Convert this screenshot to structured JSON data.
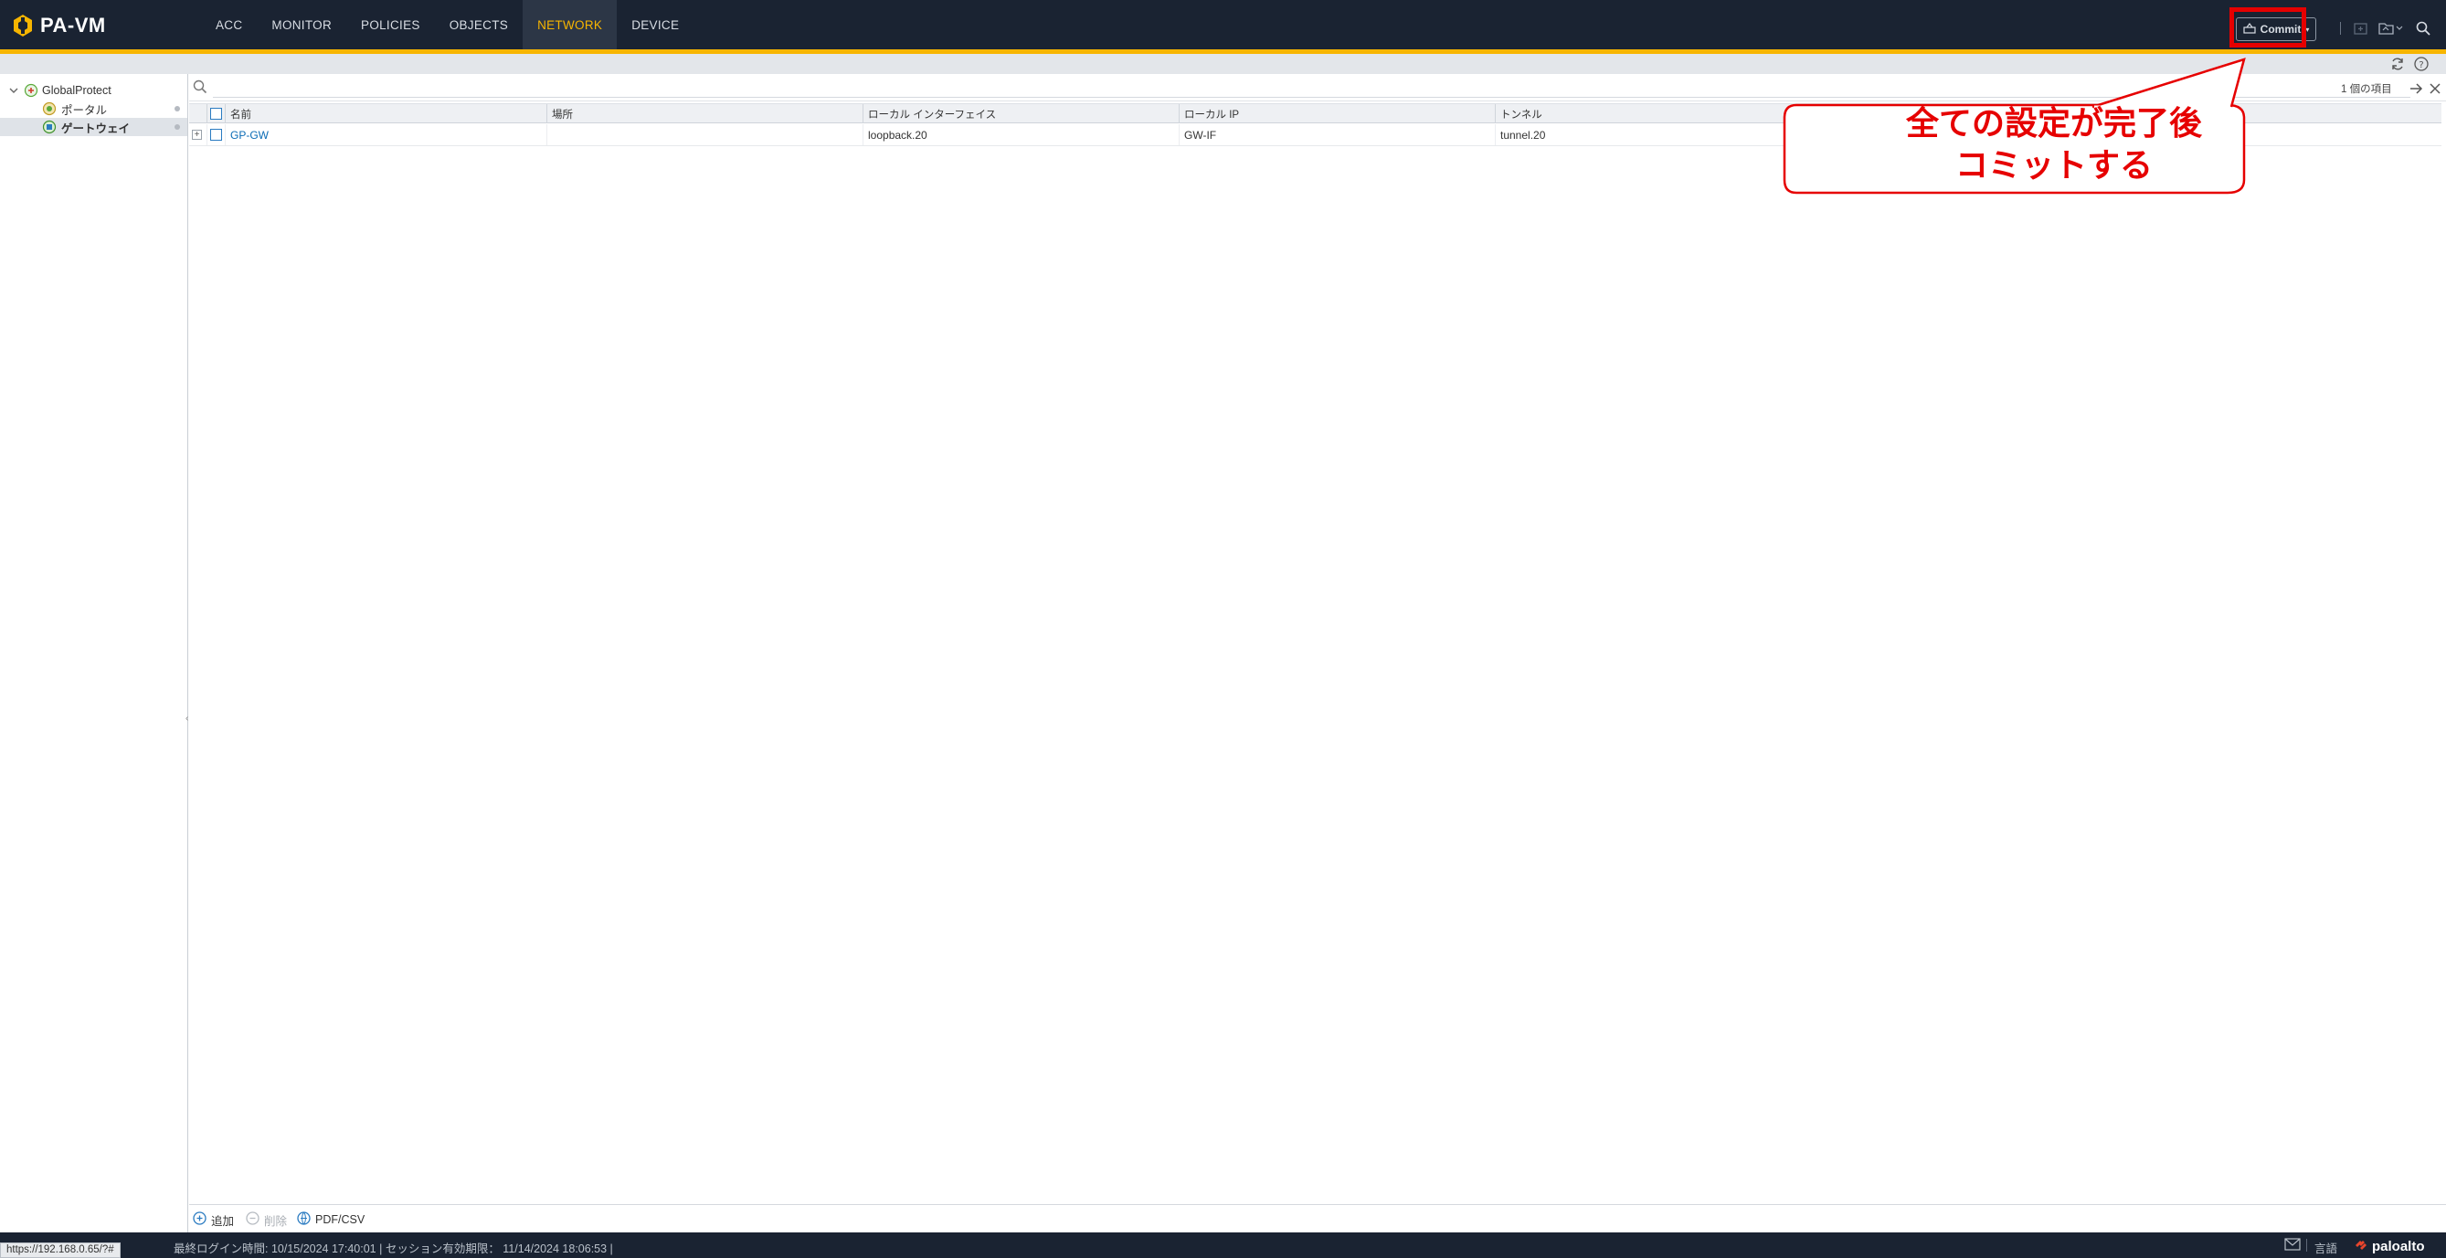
{
  "app": {
    "title": "PA-VM",
    "nav": [
      "ACC",
      "MONITOR",
      "POLICIES",
      "OBJECTS",
      "NETWORK",
      "DEVICE"
    ],
    "active_nav": "NETWORK",
    "commit_label": "Commit"
  },
  "sidebar": {
    "root_label": "GlobalProtect",
    "items": [
      {
        "label": "ポータル"
      },
      {
        "label": "ゲートウェイ"
      }
    ]
  },
  "table": {
    "item_count": "1 個の項目",
    "columns": [
      "名前",
      "場所",
      "ローカル インターフェイス",
      "ローカル IP",
      "トンネル"
    ],
    "rows": [
      {
        "name": "GP-GW",
        "location": "",
        "local_interface": "loopback.20",
        "local_ip": "GW-IF",
        "tunnel": "tunnel.20"
      }
    ]
  },
  "annotation": {
    "line1": "全ての設定が完了後",
    "line2": "コミットする",
    "color": "#e60000"
  },
  "actions": {
    "add": "追加",
    "delete": "削除",
    "pdf_csv": "PDF/CSV"
  },
  "status": {
    "text": "最終ログイン時間: 10/15/2024 17:40:01 | セッション有効期限： 11/14/2024 18:06:53 |",
    "url": "https://192.168.0.65/?#",
    "language": "言語",
    "brand": "paloalto"
  },
  "colors": {
    "header_bg": "#1a2332",
    "accent": "#f7b500",
    "link": "#0a6bb5",
    "highlight": "#e60000"
  }
}
